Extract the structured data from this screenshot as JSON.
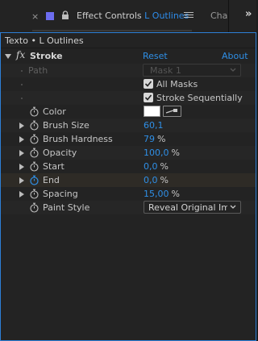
{
  "tabbar": {
    "close_glyph": "×",
    "panel_name": "Effect Controls",
    "composition": "L Outlines",
    "next_tab": "Cha",
    "overflow_glyph": "»"
  },
  "breadcrumb": "Texto • L Outlines",
  "effect": {
    "fx_glyph": "fx",
    "name": "Stroke",
    "reset": "Reset",
    "about": "About"
  },
  "path": {
    "label": "Path",
    "value": "Mask 1"
  },
  "all_masks": {
    "label": "All Masks",
    "checked": true
  },
  "stroke_sequentially": {
    "label": "Stroke Sequentially",
    "checked": true
  },
  "color": {
    "label": "Color",
    "value": "#ffffff"
  },
  "brush_size": {
    "label": "Brush Size",
    "value": "60,1"
  },
  "brush_hardness": {
    "label": "Brush Hardness",
    "value": "79",
    "unit": "%"
  },
  "opacity": {
    "label": "Opacity",
    "value": "100,0",
    "unit": "%"
  },
  "start": {
    "label": "Start",
    "value": "0,0",
    "unit": "%"
  },
  "end": {
    "label": "End",
    "value": "0,0",
    "unit": "%"
  },
  "spacing": {
    "label": "Spacing",
    "value": "15,00",
    "unit": "%"
  },
  "paint_style": {
    "label": "Paint Style",
    "value": "Reveal Original Ima"
  },
  "colors": {
    "accent": "#2f8fe6",
    "panel_border": "#2d7fd6",
    "tab_swatch": "#6d6df0",
    "background": "#232323"
  }
}
